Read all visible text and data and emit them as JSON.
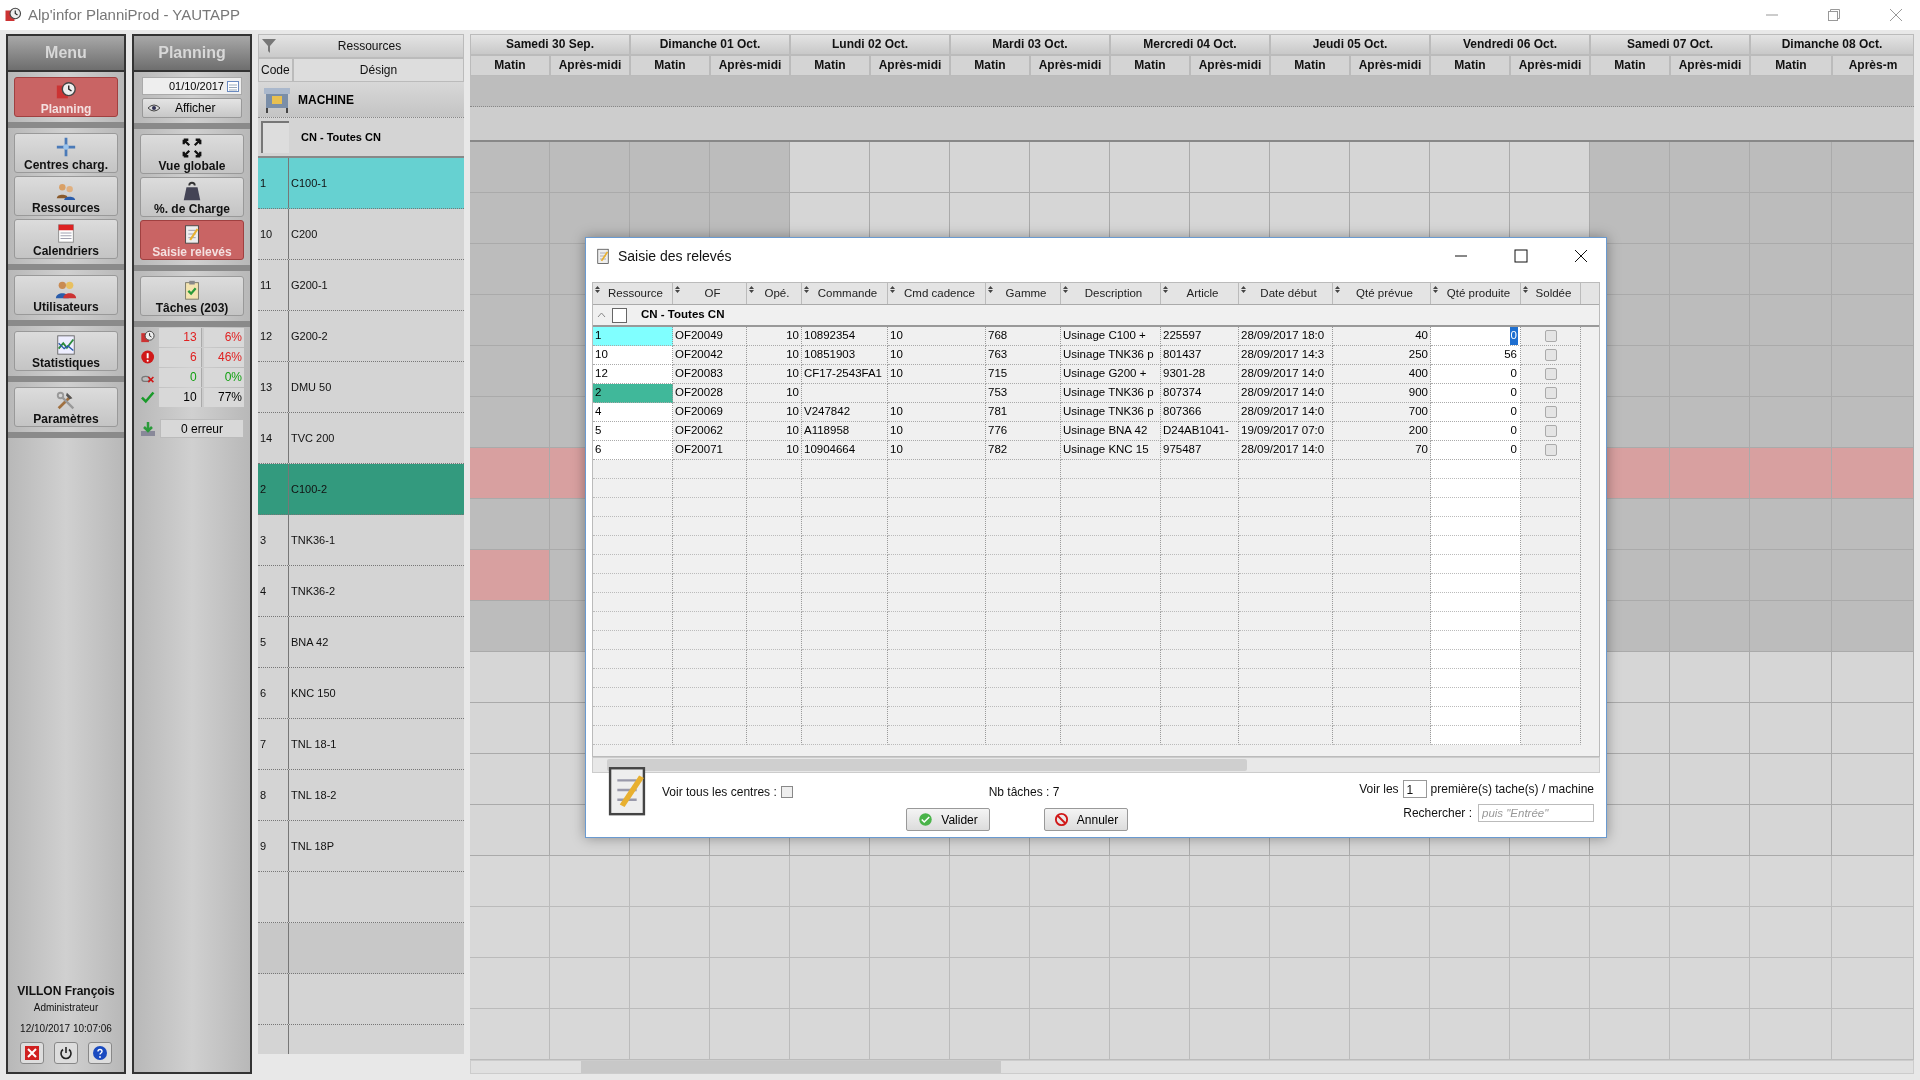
{
  "window": {
    "title": "Alp'infor PlanniProd - YAUTAPP"
  },
  "menu": {
    "title": "Menu",
    "groups": [
      {
        "buttons": [
          {
            "label": "Planning",
            "kind": "clock",
            "selected": true
          }
        ]
      },
      {
        "buttons": [
          {
            "label": "Centres charg.",
            "kind": "cross",
            "selected": false
          },
          {
            "label": "Ressources",
            "kind": "people",
            "selected": false
          },
          {
            "label": "Calendriers",
            "kind": "calendar",
            "selected": false
          }
        ]
      },
      {
        "buttons": [
          {
            "label": "Utilisateurs",
            "kind": "users",
            "selected": false
          }
        ]
      },
      {
        "buttons": [
          {
            "label": "Statistiques",
            "kind": "chart",
            "selected": false
          }
        ]
      },
      {
        "buttons": [
          {
            "label": "Paramètres",
            "kind": "tools",
            "selected": false
          }
        ]
      }
    ]
  },
  "user": {
    "name": "VILLON François",
    "role": "Administrateur",
    "datetime": "12/10/2017 10:07:06"
  },
  "planning": {
    "title": "Planning",
    "date": "01/10/2017",
    "show_button": "Afficher",
    "groups": [
      {
        "buttons": [
          {
            "label": "Vue globale",
            "kind": "expand",
            "selected": false
          },
          {
            "label": "%. de Charge",
            "kind": "weight",
            "selected": false
          },
          {
            "label": "Saisie relevés",
            "kind": "notepad",
            "selected": true
          }
        ]
      },
      {
        "buttons": [
          {
            "label": "Tâches (203)",
            "kind": "clipboard",
            "selected": false
          }
        ]
      }
    ],
    "stats": [
      {
        "kind": "clock",
        "count": "13",
        "percent": "6%",
        "color": "#e02020"
      },
      {
        "kind": "alert",
        "count": "6",
        "percent": "46%",
        "color": "#e02020"
      },
      {
        "kind": "broken",
        "count": "0",
        "percent": "0%",
        "color": "#10a010"
      },
      {
        "kind": "done",
        "count": "10",
        "percent": "77%",
        "color": "#000000"
      }
    ],
    "errors": "0 erreur"
  },
  "resources": {
    "title": "Ressources",
    "columns": [
      "Code",
      "Désign"
    ],
    "category": "MACHINE",
    "group": "CN - Toutes CN",
    "group_checked": false,
    "rows": [
      {
        "code": "1",
        "name": "C100-1",
        "color": "#66d1d1",
        "kind": "idle"
      },
      {
        "code": "10",
        "name": "C200",
        "color": "#d4d4d4",
        "kind": "idle"
      },
      {
        "code": "11",
        "name": "G200-1",
        "color": "#d4d4d4",
        "kind": "idle"
      },
      {
        "code": "12",
        "name": "G200-2",
        "color": "#d4d4d4",
        "kind": "idle"
      },
      {
        "code": "13",
        "name": "DMU 50",
        "color": "#d4d4d4",
        "kind": "idle"
      },
      {
        "code": "14",
        "name": "TVC 200",
        "color": "#d4d4d4",
        "kind": "idle"
      },
      {
        "code": "2",
        "name": "C100-2",
        "color": "#339a7e",
        "kind": "booked"
      },
      {
        "code": "3",
        "name": "TNK36-1",
        "color": "#d4d4d4",
        "kind": "idle"
      },
      {
        "code": "4",
        "name": "TNK36-2",
        "color": "#d4d4d4",
        "kind": "partial"
      },
      {
        "code": "5",
        "name": "BNA 42",
        "color": "#d4d4d4",
        "kind": "idle"
      },
      {
        "code": "6",
        "name": "KNC 150",
        "color": "#d4d4d4",
        "kind": "idle"
      },
      {
        "code": "7",
        "name": "TNL 18-1",
        "color": "#d4d4d4",
        "kind": "idle"
      },
      {
        "code": "8",
        "name": "TNL 18-2",
        "color": "#d4d4d4",
        "kind": "idle"
      },
      {
        "code": "9",
        "name": "TNL 18P",
        "color": "#d4d4d4",
        "kind": "idle"
      }
    ]
  },
  "days": [
    {
      "label": "Samedi 30 Sep.",
      "weekend": true,
      "halves": [
        "Matin",
        "Après-midi"
      ]
    },
    {
      "label": "Dimanche 01 Oct.",
      "weekend": true,
      "halves": [
        "Matin",
        "Après-midi"
      ]
    },
    {
      "label": "Lundi 02 Oct.",
      "weekend": false,
      "halves": [
        "Matin",
        "Après-midi"
      ]
    },
    {
      "label": "Mardi 03 Oct.",
      "weekend": false,
      "halves": [
        "Matin",
        "Après-midi"
      ]
    },
    {
      "label": "Mercredi 04 Oct.",
      "weekend": false,
      "halves": [
        "Matin",
        "Après-midi"
      ]
    },
    {
      "label": "Jeudi 05 Oct.",
      "weekend": false,
      "halves": [
        "Matin",
        "Après-midi"
      ]
    },
    {
      "label": "Vendredi 06 Oct.",
      "weekend": false,
      "halves": [
        "Matin",
        "Après-midi"
      ]
    },
    {
      "label": "Samedi 07 Oct.",
      "weekend": true,
      "halves": [
        "Matin",
        "Après-midi"
      ]
    },
    {
      "label": "Dimanche 08 Oct.",
      "weekend": true,
      "halves": [
        "Matin",
        "Après-m"
      ]
    }
  ],
  "dialog": {
    "title": "Saisie des relevés",
    "columns": [
      "Ressource",
      "OF",
      "Opé.",
      "Commande",
      "Cmd cadence",
      "Gamme",
      "Description",
      "Article",
      "Date début",
      "Qté prévue",
      "Qté produite",
      "Soldée"
    ],
    "group": "CN - Toutes CN",
    "group_checked": false,
    "rows": [
      {
        "ressource": "1",
        "color": "#80ffff",
        "of": "OF20049",
        "ope": "10",
        "commande": "10892354",
        "cadence": "10",
        "gamme": "768",
        "description": "Usinage C100 +",
        "article": "225597",
        "date": "28/09/2017 18:0",
        "prevue": "40",
        "produite": "0",
        "selected": true,
        "soldee": false
      },
      {
        "ressource": "10",
        "color": "#ffffff",
        "of": "OF20042",
        "ope": "10",
        "commande": "10851903",
        "cadence": "10",
        "gamme": "763",
        "description": "Usinage TNK36 p",
        "article": "801437",
        "date": "28/09/2017 14:3",
        "prevue": "250",
        "produite": "56",
        "selected": false,
        "soldee": false
      },
      {
        "ressource": "12",
        "color": "#ffffff",
        "of": "OF20083",
        "ope": "10",
        "commande": "CF17-2543FA1",
        "cadence": "10",
        "gamme": "715",
        "description": "Usinage G200 +",
        "article": "9301-28",
        "date": "28/09/2017 14:0",
        "prevue": "400",
        "produite": "0",
        "selected": false,
        "soldee": false
      },
      {
        "ressource": "2",
        "color": "#40b89a",
        "of": "OF20028",
        "ope": "10",
        "gamme": "753",
        "description": "Usinage TNK36 p",
        "article": "807374",
        "date": "28/09/2017 14:0",
        "prevue": "900",
        "produite": "0",
        "selected": false,
        "soldee": false
      },
      {
        "ressource": "4",
        "color": "#ffffff",
        "of": "OF20069",
        "ope": "10",
        "commande": "V247842",
        "cadence": "10",
        "gamme": "781",
        "description": "Usinage TNK36 p",
        "article": "807366",
        "date": "28/09/2017 14:0",
        "prevue": "700",
        "produite": "0",
        "selected": false,
        "soldee": false
      },
      {
        "ressource": "5",
        "color": "#ffffff",
        "of": "OF20062",
        "ope": "10",
        "commande": "A118958",
        "cadence": "10",
        "gamme": "776",
        "description": "Usinage BNA 42",
        "article": "D24AB1041-",
        "date": "19/09/2017 07:0",
        "prevue": "200",
        "produite": "0",
        "selected": false,
        "soldee": false
      },
      {
        "ressource": "6",
        "color": "#ffffff",
        "of": "OF20071",
        "ope": "10",
        "commande": "10904664",
        "cadence": "10",
        "gamme": "782",
        "description": "Usinage KNC 15",
        "article": "975487",
        "date": "28/09/2017 14:0",
        "prevue": "70",
        "produite": "0",
        "selected": false,
        "soldee": false
      }
    ],
    "show_all_label": "Voir tous les centres :",
    "show_all": false,
    "count": "Nb tâches : 7",
    "voir_prefix": "Voir les",
    "voir_value": "1",
    "voir_suffix": "première(s) tache(s) / machine",
    "search_label": "Rechercher :",
    "search_placeholder": "puis \"Entrée\"",
    "buttons": [
      {
        "label": "Valider",
        "kind": "ok"
      },
      {
        "label": "Annuler",
        "kind": "cancel"
      }
    ]
  }
}
